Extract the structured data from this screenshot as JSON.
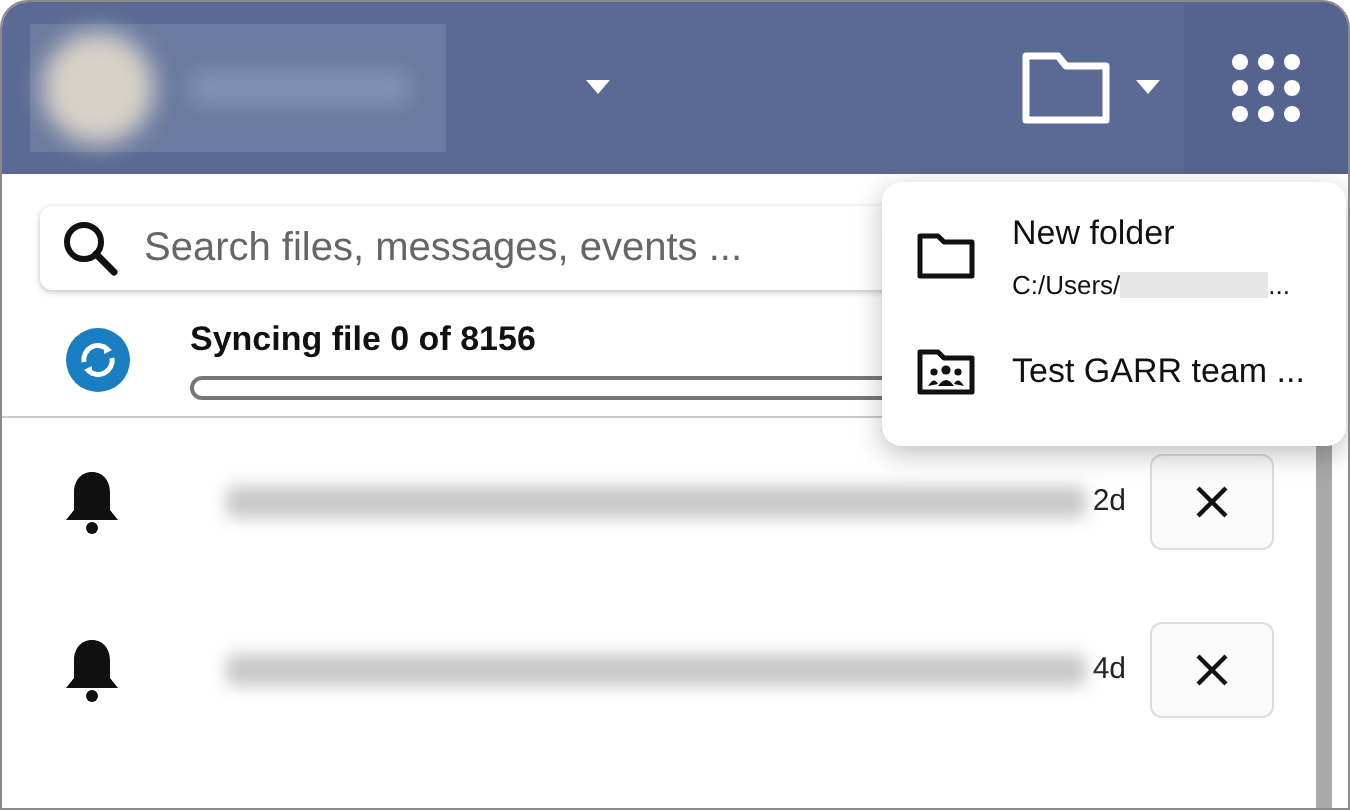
{
  "search": {
    "placeholder": "Search files, messages, events ..."
  },
  "sync": {
    "label": "Syncing file 0 of 8156",
    "level": 0
  },
  "notifications": [
    {
      "time": "2d"
    },
    {
      "time": "4d"
    }
  ],
  "menu": [
    {
      "kind": "folder",
      "label": "New folder",
      "path_start": "C:/Users/",
      "path_end": "..."
    },
    {
      "kind": "team",
      "label": "Test GARR team ..."
    }
  ]
}
